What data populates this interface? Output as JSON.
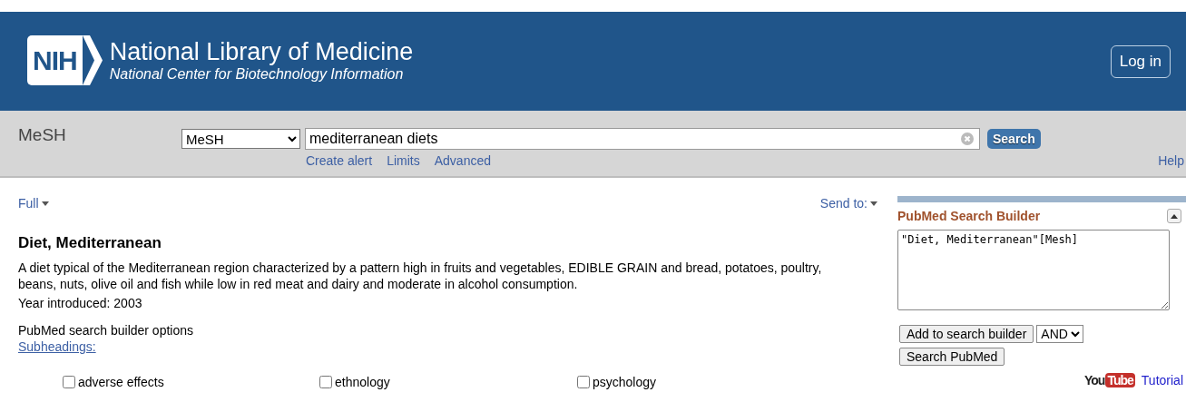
{
  "header": {
    "logo_text": "NIH",
    "title": "National Library of Medicine",
    "subtitle": "National Center for Biotechnology Information",
    "login": "Log in"
  },
  "search_bar": {
    "database_label": "MeSH",
    "database": "MeSH",
    "query": "mediterranean diets",
    "search_button": "Search",
    "links": [
      "Create alert",
      "Limits",
      "Advanced"
    ],
    "help": "Help"
  },
  "record": {
    "display_menu": "Full",
    "send_to": "Send to:",
    "heading": "Diet, Mediterranean",
    "description": "A diet typical of the Mediterranean region characterized by a pattern high in fruits and vegetables, EDIBLE GRAIN and bread, potatoes, poultry, beans, nuts, olive oil and fish while low in red meat and dairy and moderate in alcohol consumption.",
    "year": "Year introduced: 2003",
    "options_label": "PubMed search builder options",
    "subheadings_link": "Subheadings:",
    "subheadings": [
      {
        "label": "adverse effects",
        "checked": false
      },
      {
        "label": "ethnology",
        "checked": false
      },
      {
        "label": "psychology",
        "checked": false
      }
    ]
  },
  "builder": {
    "title": "PubMed Search Builder",
    "query": "\"Diet, Mediterranean\"[Mesh]",
    "add_button": "Add to search builder",
    "operator": "AND",
    "search_button": "Search PubMed",
    "logo_you": "You",
    "logo_tube": "Tube",
    "tutorial": "Tutorial"
  }
}
